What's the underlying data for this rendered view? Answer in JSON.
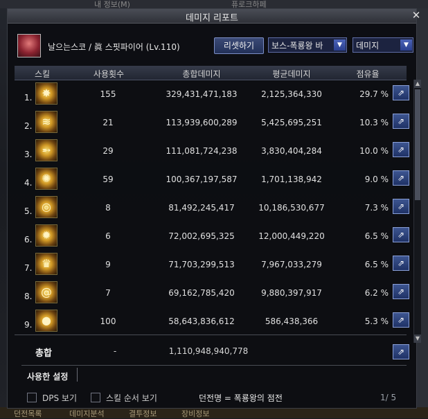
{
  "background": {
    "top_labels": [
      "내 정보(M)",
      "퓨로크하페"
    ],
    "bottom_labels": [
      "던전목록",
      "데미지분석",
      "결투정보",
      "장비정보"
    ]
  },
  "window": {
    "title": "데미지 리포트",
    "close_label": "✕"
  },
  "header": {
    "character_name": "날으는스코 / 眞 스핏파이어 (Lv.110)",
    "reset_button": "리셋하기",
    "dungeon_select": "보스-폭룡왕 바",
    "metric_select": "데미지"
  },
  "table": {
    "columns": [
      "스킬",
      "사용횟수",
      "총합데미지",
      "평균데미지",
      "점유율"
    ],
    "rows": [
      {
        "num": "1.",
        "uses": "155",
        "total": "329,431,471,183",
        "avg": "2,125,364,330",
        "share": "29.7 %",
        "icon": "grenade-burst-icon"
      },
      {
        "num": "2.",
        "uses": "21",
        "total": "113,939,600,289",
        "avg": "5,425,695,251",
        "share": "10.3 %",
        "icon": "fire-wave-icon"
      },
      {
        "num": "3.",
        "uses": "29",
        "total": "111,081,724,238",
        "avg": "3,830,404,284",
        "share": "10.0 %",
        "icon": "bullet-shot-icon"
      },
      {
        "num": "4.",
        "uses": "59",
        "total": "100,367,197,587",
        "avg": "1,701,138,942",
        "share": "9.0 %",
        "icon": "flash-beam-icon"
      },
      {
        "num": "5.",
        "uses": "8",
        "total": "81,492,245,417",
        "avg": "10,186,530,677",
        "share": "7.3 %",
        "icon": "vortex-icon"
      },
      {
        "num": "6.",
        "uses": "6",
        "total": "72,002,695,325",
        "avg": "12,000,449,220",
        "share": "6.5 %",
        "icon": "explosion-icon"
      },
      {
        "num": "7.",
        "uses": "9",
        "total": "71,703,299,513",
        "avg": "7,967,033,279",
        "share": "6.5 %",
        "icon": "crowned-blast-icon"
      },
      {
        "num": "8.",
        "uses": "7",
        "total": "69,162,785,420",
        "avg": "9,880,397,917",
        "share": "6.2 %",
        "icon": "spiral-icon"
      },
      {
        "num": "9.",
        "uses": "100",
        "total": "58,643,836,612",
        "avg": "586,438,366",
        "share": "5.3 %",
        "icon": "bomb-icon"
      }
    ],
    "share_icon": "share-icon"
  },
  "total": {
    "label": "총합",
    "uses": "-",
    "damage": "1,110,948,940,778"
  },
  "settings_label": "사용한 설정",
  "footer": {
    "dps_label": "DPS 보기",
    "skill_order_label": "스킬 순서 보기",
    "dungeon_name": "던전명 = 폭룡왕의 점전",
    "page": "1/ 5"
  }
}
